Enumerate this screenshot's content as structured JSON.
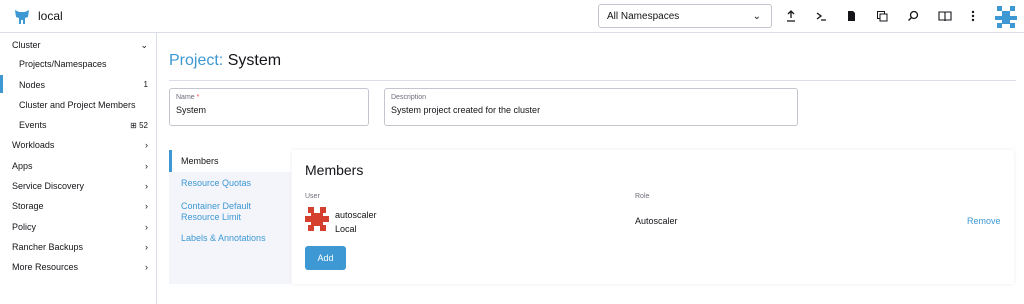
{
  "header": {
    "cluster_name": "local",
    "namespace_filter": "All Namespaces",
    "colors": {
      "accent": "#3d98d3"
    },
    "icons": [
      "cluster-logo-icon",
      "upload-icon",
      "terminal-icon",
      "file-icon",
      "copy-icon",
      "search-icon",
      "book-icon",
      "more-vertical-icon",
      "user-avatar-icon"
    ]
  },
  "sidebar": {
    "cluster": "Cluster",
    "items": [
      {
        "label": "Projects/Namespaces",
        "count": ""
      },
      {
        "label": "Nodes",
        "count": "1"
      },
      {
        "label": "Cluster and Project Members",
        "count": ""
      },
      {
        "label": "Events",
        "count": "52"
      }
    ],
    "groups": [
      "Workloads",
      "Apps",
      "Service Discovery",
      "Storage",
      "Policy",
      "Rancher Backups",
      "More Resources"
    ]
  },
  "page": {
    "title_prefix": "Project:",
    "title_name": "System",
    "name_label": "Name",
    "name_required": "*",
    "name_value": "System",
    "description_label": "Description",
    "description_value": "System project created for the cluster"
  },
  "tabs": [
    "Members",
    "Resource Quotas",
    "Container Default",
    "Resource Limit",
    "Labels & Annotations"
  ],
  "members": {
    "heading": "Members",
    "col_user": "User",
    "col_role": "Role",
    "rows": [
      {
        "name": "autoscaler",
        "provider": "Local",
        "role": "Autoscaler",
        "action": "Remove"
      }
    ],
    "add_label": "Add"
  }
}
